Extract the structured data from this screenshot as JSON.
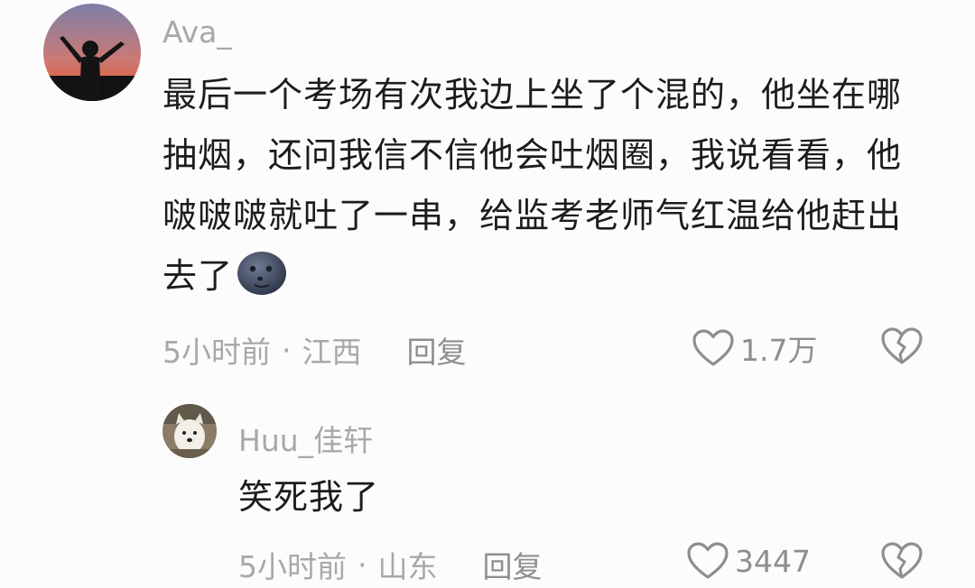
{
  "comments": [
    {
      "username": "Ava_",
      "content": "最后一个考场有次我边上坐了个混的，他坐在哪抽烟，还问我信不信他会吐烟圈，我说看看，他啵啵啵就吐了一串，给监考老师气红温给他赶出去了",
      "emoji": "new-moon-face-emoji",
      "time": "5小时前",
      "separator": "·",
      "location": "江西",
      "reply_label": "回复",
      "likes": "1.7万",
      "like_icon": "heart-outline-icon",
      "dislike_icon": "broken-heart-icon"
    },
    {
      "username": "Huu_佳轩",
      "content": "笑死我了",
      "time": "5小时前",
      "separator": "·",
      "location": "山东",
      "reply_label": "回复",
      "likes": "3447",
      "like_icon": "heart-outline-icon",
      "dislike_icon": "broken-heart-icon"
    }
  ],
  "colors": {
    "background": "#fcfcfc",
    "text": "#1c1c1c",
    "muted": "#a8a8a8",
    "icon": "#8e8e8e"
  }
}
